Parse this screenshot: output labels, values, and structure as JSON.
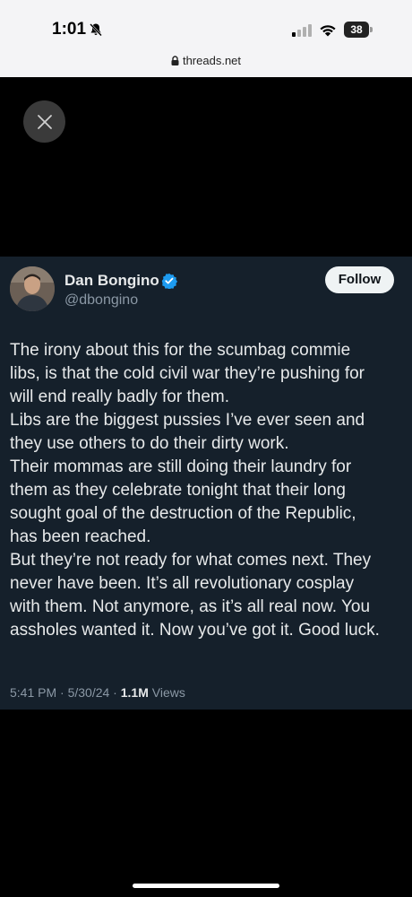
{
  "status_bar": {
    "time": "1:01",
    "battery": "38"
  },
  "browser": {
    "url": "threads.net"
  },
  "tweet": {
    "author_name": "Dan Bongino",
    "author_handle": "@dbongino",
    "follow_label": "Follow",
    "lines": [
      "The irony about this for the scumbag commie",
      "libs, is that the cold civil war they’re pushing for",
      "will end really badly for them.",
      "Libs are the biggest pussies I’ve ever seen and",
      "they use others to do their dirty work.",
      "Their mommas are still doing their laundry for",
      "them as they celebrate tonight that their long",
      "sought goal of the destruction of the Republic,",
      "has been reached.",
      "But they’re not ready for what comes next. They",
      "never have been. It’s all revolutionary cosplay",
      "with them. Not anymore, as it’s all real now. You",
      "assholes wanted it. Now you’ve got it. Good luck."
    ],
    "meta_prefix": "5:41 PM · 5/30/24 · ",
    "views_count": "1.1M",
    "views_label": " Views"
  },
  "colors": {
    "card_bg": "#15202b",
    "verified_blue": "#1d9bf0",
    "text_primary": "#e7e9ea",
    "text_secondary": "#8b98a5"
  }
}
